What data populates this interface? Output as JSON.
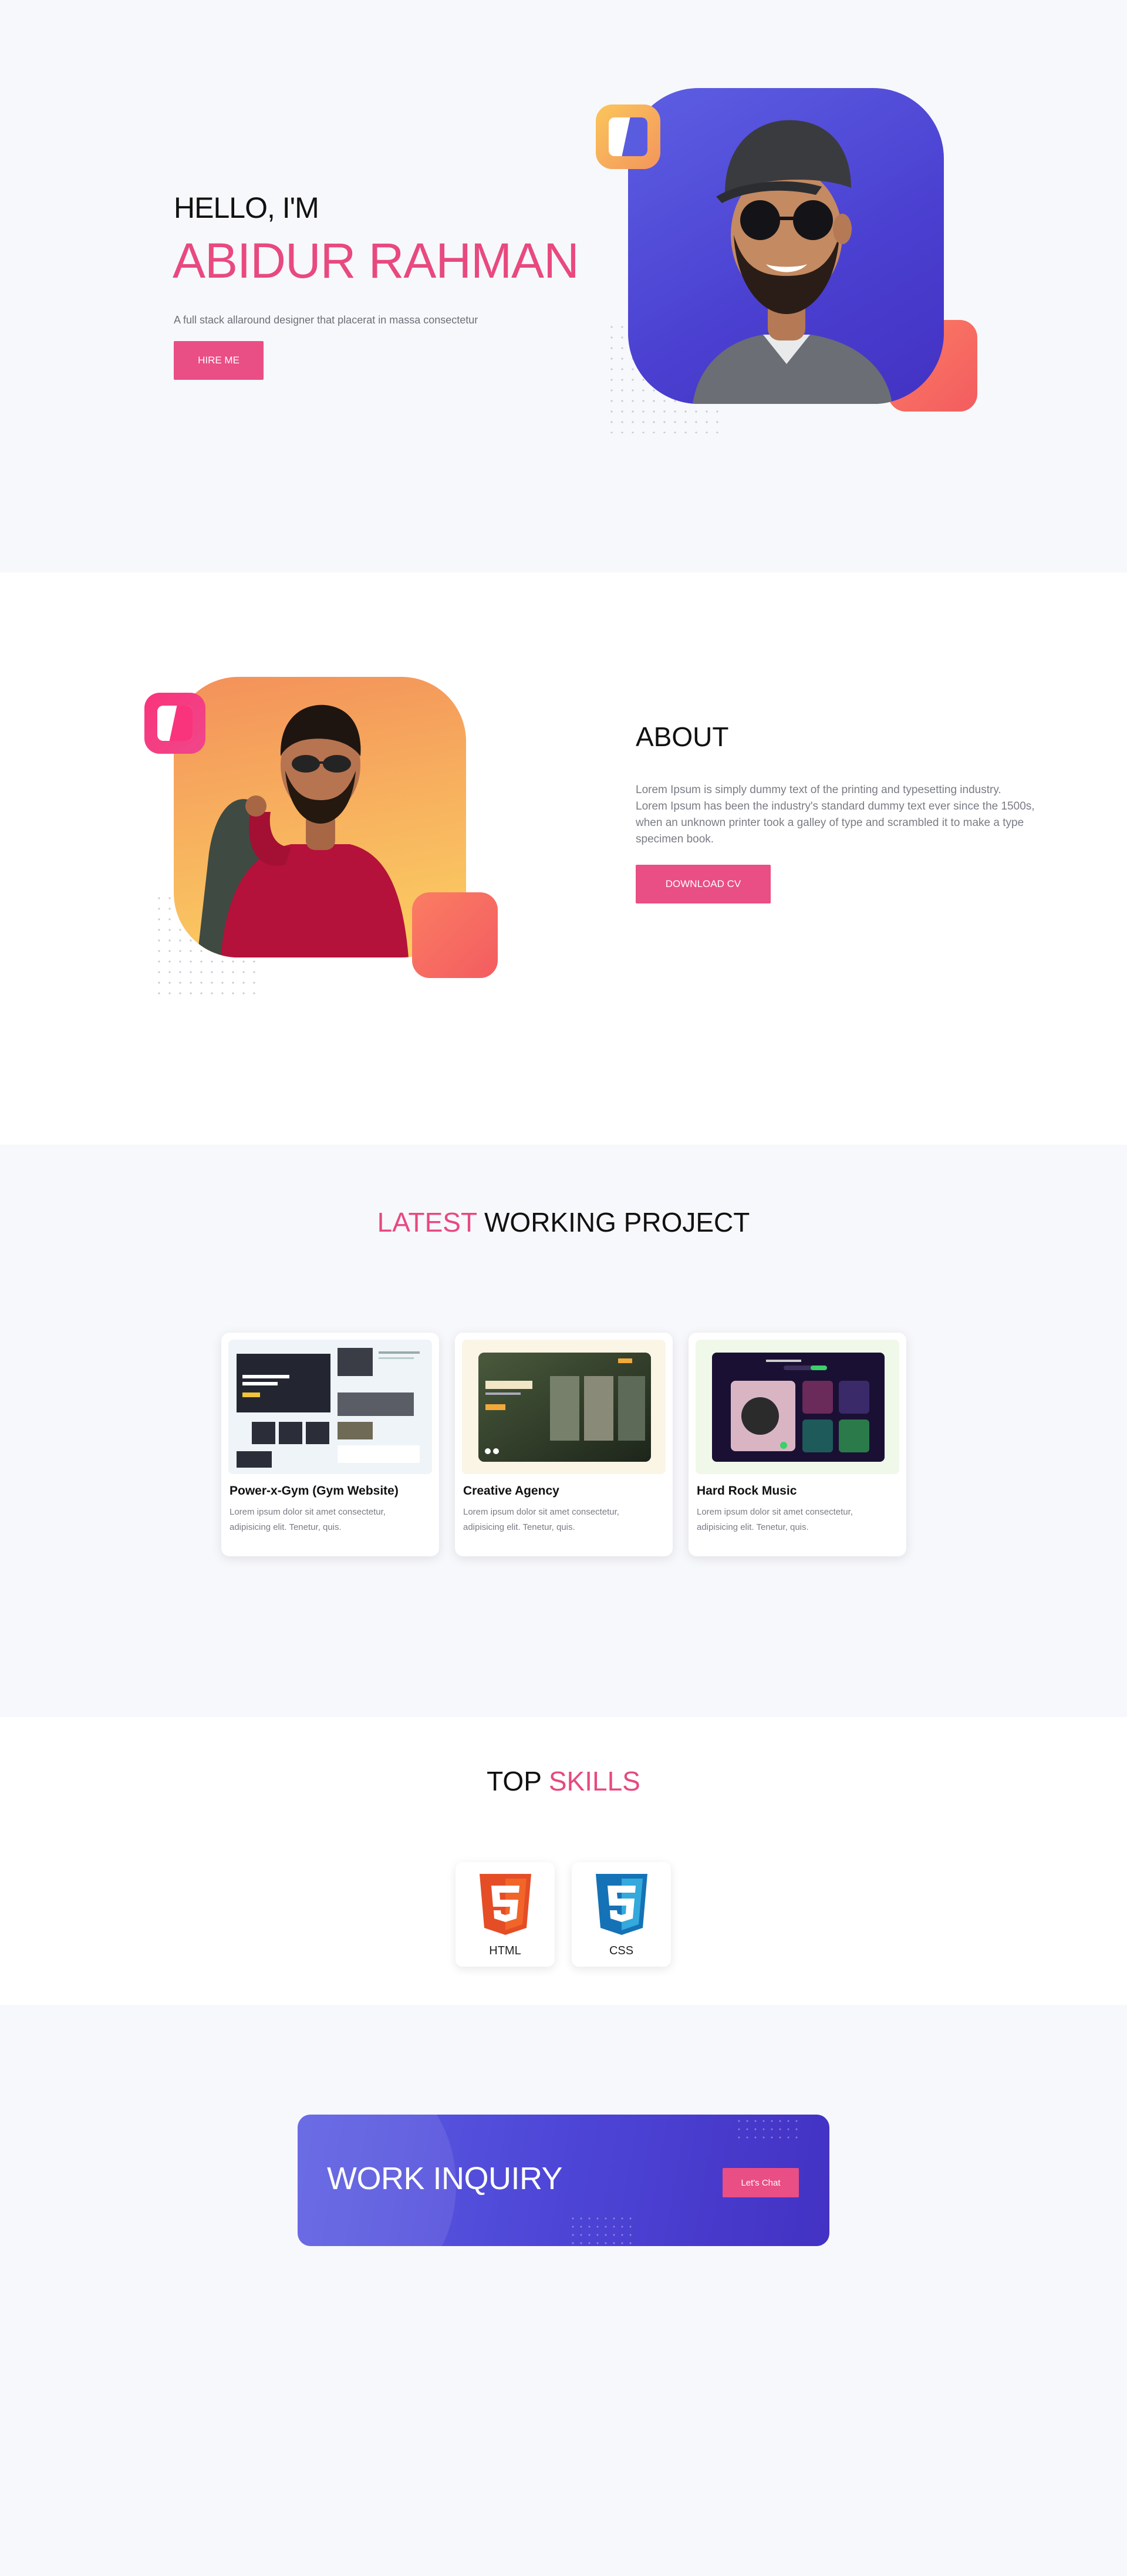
{
  "hero": {
    "greeting": "HELLO, I'M",
    "name": "ABIDUR RAHMAN",
    "description": "A full stack allaround designer that placerat in massa consectetur",
    "button_label": "HIRE ME"
  },
  "about": {
    "title": "ABOUT",
    "text": "Lorem Ipsum is simply dummy text of the printing and typesetting industry. Lorem Ipsum has been the industry's standard dummy text ever since the 1500s, when an unknown printer took a galley of type and scrambled it to make a type specimen book.",
    "button_label": "DOWNLOAD CV"
  },
  "projects": {
    "title_highlight": "LATEST",
    "title_rest": " WORKING PROJECT",
    "items": [
      {
        "title": "Power-x-Gym (Gym Website)",
        "description": "Lorem ipsum dolor sit amet consectetur, adipisicing elit. Tenetur, quis."
      },
      {
        "title": "Creative Agency",
        "description": "Lorem ipsum dolor sit amet consectetur, adipisicing elit. Tenetur, quis."
      },
      {
        "title": "Hard Rock Music",
        "description": "Lorem ipsum dolor sit amet consectetur, adipisicing elit. Tenetur, quis."
      }
    ]
  },
  "skills": {
    "title_plain": "TOP ",
    "title_highlight": "SKILLS",
    "items": [
      {
        "label": "HTML",
        "icon": "html5-icon"
      },
      {
        "label": "CSS",
        "icon": "css3-icon"
      }
    ]
  },
  "inquiry": {
    "title": "WORK INQUIRY",
    "button_label": "Let's Chat"
  },
  "colors": {
    "accent_pink": "#e8497f",
    "accent_purple": "#5558e0",
    "accent_orange": "#f7a75d",
    "accent_coral": "#f86a60"
  }
}
